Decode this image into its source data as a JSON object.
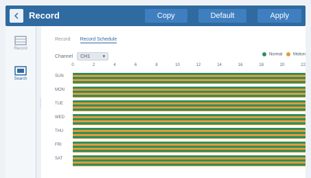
{
  "header": {
    "title": "Record",
    "buttons": [
      "Copy",
      "Default",
      "Apply"
    ]
  },
  "sidebar": {
    "items": [
      {
        "label": "Record"
      },
      {
        "label": "Search"
      }
    ]
  },
  "tabs": [
    "Record",
    "Record Schedule"
  ],
  "channel": {
    "label": "Channel",
    "value": "CH1"
  },
  "legend": [
    {
      "label": "Normal",
      "color": "#2f8f5a"
    },
    {
      "label": "Motion",
      "color": "#e39a3b"
    }
  ],
  "schedule": {
    "hours": [
      "0",
      "2",
      "4",
      "6",
      "8",
      "10",
      "12",
      "14",
      "16",
      "18",
      "20",
      "22"
    ],
    "days": [
      "SUN",
      "MON",
      "TUE",
      "WED",
      "THU",
      "FRI",
      "SAT"
    ]
  }
}
